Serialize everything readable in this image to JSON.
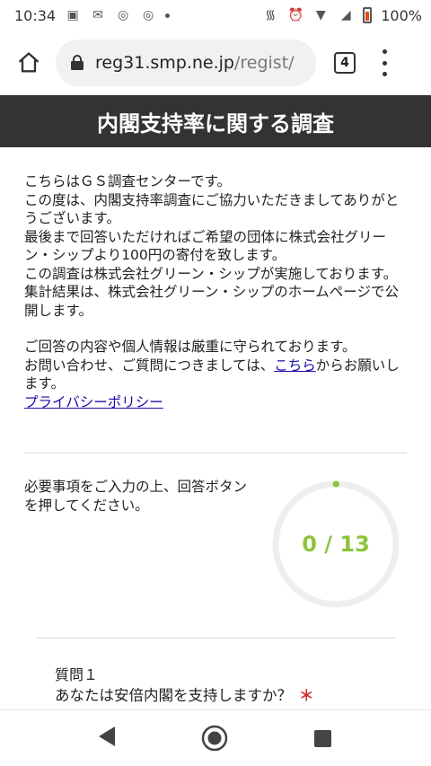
{
  "status_bar": {
    "time": "10:34",
    "battery": "100%"
  },
  "browser": {
    "url_host": "reg31.smp.ne.jp",
    "url_path": "/regist/",
    "tab_count": "4"
  },
  "page": {
    "title": "内閣支持率に関する調査",
    "intro": {
      "line1": "こちらはＧＳ調査センターです。",
      "line2": "この度は、内閣支持率調査にご協力いただきましてありがとうございます。",
      "line3": "最後まで回答いただければご希望の団体に株式会社グリーン・シップより100円の寄付を致します。",
      "line4": "この調査は株式会社グリーン・シップが実施しております。",
      "line5": "集計結果は、株式会社グリーン・シップのホームページで公開します。",
      "line6": "ご回答の内容や個人情報は厳重に守られております。",
      "line7_before": "お問い合わせ、ご質問につきましては、",
      "line7_link": "こちら",
      "line7_after": "からお願いします。",
      "privacy_link": "プライバシーポリシー"
    },
    "progress": {
      "instruction": "必要事項をご入力の上、回答ボタンを押してください。",
      "label": "0 / 13",
      "answered": 0,
      "total": 13
    },
    "question": {
      "number": "質問１",
      "text": "あなたは安倍内閣を支持しますか？",
      "required_mark": "＊"
    }
  },
  "colors": {
    "header_bg": "#333333",
    "accent_green": "#8cc43c",
    "link": "#1a0dab",
    "required": "#d32f2f"
  }
}
